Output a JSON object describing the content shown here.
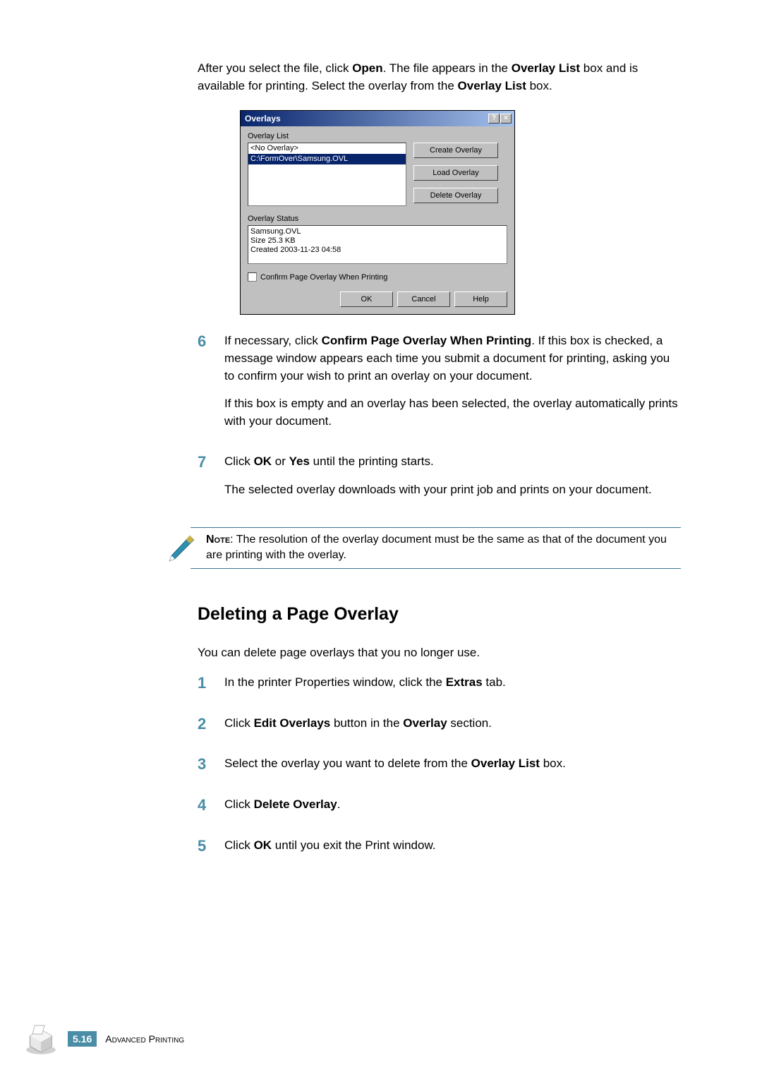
{
  "intro": {
    "p1a": "After you select the file, click ",
    "p1b": "Open",
    "p1c": ". The file appears in the ",
    "p1d": "Overlay List",
    "p1e": " box and is available for printing. Select the overlay from the ",
    "p1f": "Overlay List",
    "p1g": " box."
  },
  "dialog": {
    "title": "Overlays",
    "help_icon": "?",
    "close_icon": "×",
    "overlay_list_label": "Overlay List",
    "item_no_overlay": "<No Overlay>",
    "item_selected": "C:\\FormOver\\Samsung.OVL",
    "btn_create": "Create Overlay",
    "btn_load": "Load Overlay",
    "btn_delete": "Delete Overlay",
    "status_label": "Overlay Status",
    "status_line1": "Samsung.OVL",
    "status_line2": "Size 25.3 KB",
    "status_line3": "Created 2003-11-23 04:58",
    "confirm_checkbox": "Confirm Page Overlay When Printing",
    "btn_ok": "OK",
    "btn_cancel": "Cancel",
    "btn_help": "Help"
  },
  "steps_first": {
    "s6_num": "6",
    "s6_p1a": "If necessary, click ",
    "s6_p1b": "Confirm Page Overlay When Printing",
    "s6_p1c": ". If this box is checked, a message window appears each time you submit a document for printing, asking you to confirm your wish to print an overlay on your document.",
    "s6_p2": "If this box is empty and an overlay has been selected, the overlay automatically prints with your document.",
    "s7_num": "7",
    "s7_p1a": "Click ",
    "s7_p1b": "OK",
    "s7_p1c": " or ",
    "s7_p1d": "Yes",
    "s7_p1e": " until the printing starts.",
    "s7_p2": "The selected overlay downloads with your print job and prints on your document."
  },
  "note": {
    "label": "Note",
    "text": ": The resolution of the overlay document must be the same as that of the document you are printing with the overlay."
  },
  "heading": "Deleting a Page Overlay",
  "after_heading": "You can delete page overlays that you no longer use.",
  "steps_second": {
    "s1_num": "1",
    "s1a": "In the printer Properties window, click the ",
    "s1b": "Extras",
    "s1c": " tab.",
    "s2_num": "2",
    "s2a": "Click ",
    "s2b": "Edit Overlays",
    "s2c": " button in the ",
    "s2d": "Overlay",
    "s2e": " section.",
    "s3_num": "3",
    "s3a": "Select the overlay you want to delete from the ",
    "s3b": "Overlay List",
    "s3c": " box.",
    "s4_num": "4",
    "s4a": "Click ",
    "s4b": "Delete Overlay",
    "s4c": ".",
    "s5_num": "5",
    "s5a": "Click ",
    "s5b": "OK",
    "s5c": " until you exit the Print window."
  },
  "footer": {
    "page_prefix": "5.",
    "page_num": "16",
    "chapter": "Advanced Printing"
  }
}
